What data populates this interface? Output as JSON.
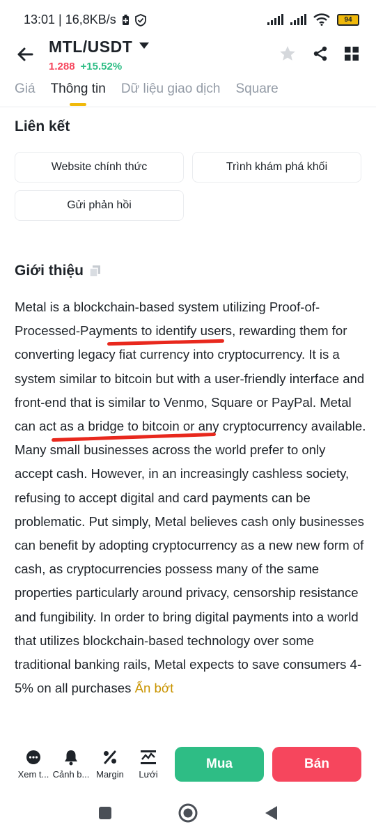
{
  "status": {
    "time_speed": "13:01 | 16,8KB/s",
    "battery": "94"
  },
  "header": {
    "pair": "MTL/USDT",
    "price": "1.288",
    "change": "+15.52%"
  },
  "tabs": [
    {
      "label": "Giá"
    },
    {
      "label": "Thông tin"
    },
    {
      "label": "Dữ liệu giao dịch"
    },
    {
      "label": "Square"
    }
  ],
  "links": {
    "title": "Liên kết",
    "website": "Website chính thức",
    "explorer": "Trình khám phá khối",
    "feedback": "Gửi phản hồi"
  },
  "intro": {
    "title": "Giới thiệu",
    "text": "Metal is a blockchain-based system utilizing Proof-of-Processed-Payments to identify users, rewarding them for converting legacy fiat currency into cryptocurrency. It is a system similar to bitcoin but with a user-friendly interface and front-end that is similar to Venmo, Square or PayPal. Metal can act as a bridge to bitcoin or any cryptocurrency available. Many small businesses across the world prefer to only accept cash. However, in an increasingly cashless society, refusing to accept digital and card payments can be problematic. Put simply, Metal believes cash only businesses can benefit by adopting cryptocurrency as a new new form of cash, as cryptocurrencies possess many of the same properties particularly around privacy, censorship resistance and fungibility. In order to bring digital payments into a world that utilizes blockchain-based technology over some traditional banking rails, Metal expects to save consumers 4-5% on all purchases",
    "less": "Ẩn bớt"
  },
  "actions": {
    "more": "Xem t...",
    "alert": "Cảnh b...",
    "margin": "Margin",
    "grid": "Lưới",
    "buy": "Mua",
    "sell": "Bán"
  },
  "colors": {
    "accent": "#f0b90b",
    "buy": "#2ebd85",
    "sell": "#f6465d",
    "link": "#c99400",
    "annotation": "#e8281d"
  }
}
